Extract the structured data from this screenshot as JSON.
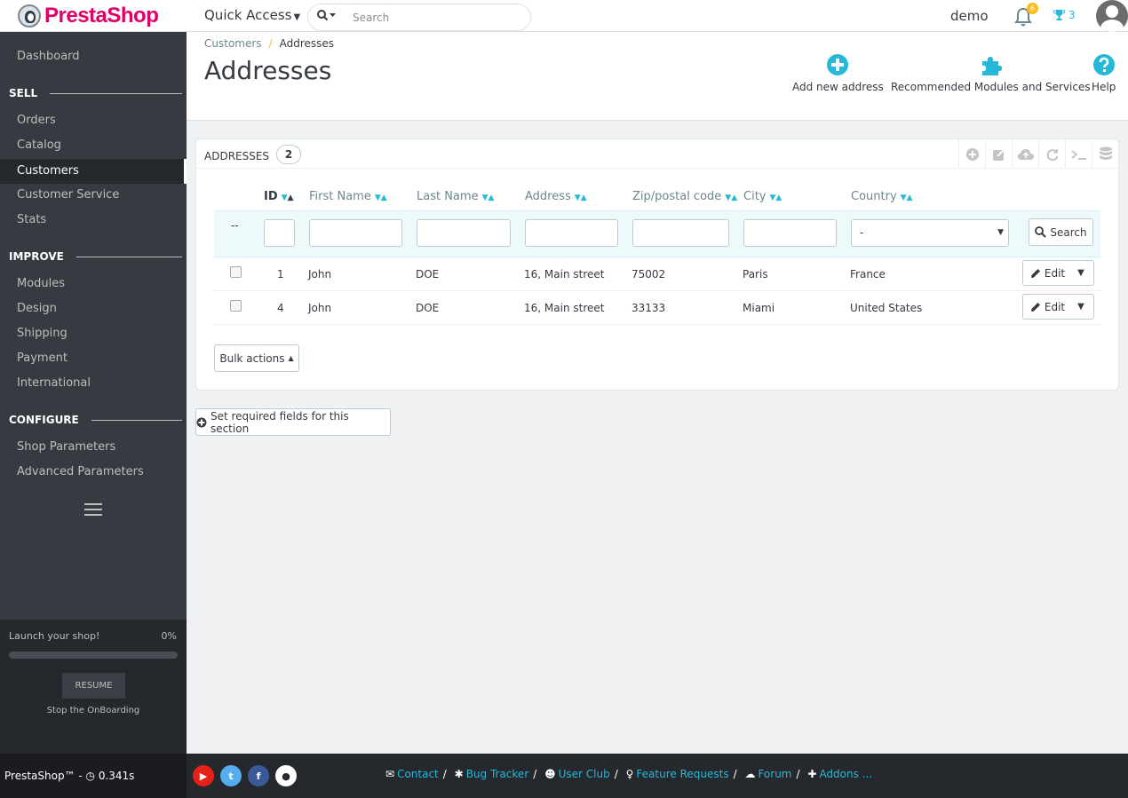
{
  "header": {
    "logo_text": "PrestaShop",
    "quick_access": "Quick Access",
    "search_placeholder": "Search",
    "employee": "demo",
    "notifications_count": "6",
    "trophy_count": "3"
  },
  "sidebar": {
    "dashboard": "Dashboard",
    "section_sell": "SELL",
    "sell_items": [
      "Orders",
      "Catalog",
      "Customers",
      "Customer Service",
      "Stats"
    ],
    "section_improve": "IMPROVE",
    "improve_items": [
      "Modules",
      "Design",
      "Shipping",
      "Payment",
      "International"
    ],
    "section_configure": "CONFIGURE",
    "configure_items": [
      "Shop Parameters",
      "Advanced Parameters"
    ],
    "active_item": "Customers",
    "onboarding": {
      "title": "Launch your shop!",
      "percent_label": "0%",
      "progress": 0,
      "resume": "RESUME",
      "stop": "Stop the OnBoarding"
    }
  },
  "pagehead": {
    "breadcrumb_parent": "Customers",
    "breadcrumb_current": "Addresses",
    "title": "Addresses",
    "toolbar": {
      "add": "Add new address",
      "modules": "Recommended Modules and Services",
      "help": "Help"
    }
  },
  "panel": {
    "title": "ADDRESSES",
    "count": "2",
    "columns": {
      "id": "ID",
      "first_name": "First Name",
      "last_name": "Last Name",
      "address": "Address",
      "zip": "Zip/postal code",
      "city": "City",
      "country": "Country"
    },
    "filter_dash": "--",
    "country_filter": "-",
    "search_button": "Search",
    "rows": [
      {
        "id": "1",
        "first_name": "John",
        "last_name": "DOE",
        "address": "16, Main street",
        "zip": "75002",
        "city": "Paris",
        "country": "France"
      },
      {
        "id": "4",
        "first_name": "John",
        "last_name": "DOE",
        "address": "16, Main street",
        "zip": "33133",
        "city": "Miami",
        "country": "United States"
      }
    ],
    "edit_label": "Edit",
    "bulk_actions": "Bulk actions"
  },
  "required_fields": "Set required fields for this section",
  "footer": {
    "version": "PrestaShop™ - ",
    "load_time": "0.341s",
    "links": [
      "Contact",
      "Bug Tracker",
      "User Club",
      "Feature Requests",
      "Forum",
      "Addons ..."
    ]
  },
  "colors": {
    "brand": "#df0067",
    "accent": "#25b9d7",
    "sidebar_bg": "#363a41",
    "warning": "#fbbb22"
  }
}
